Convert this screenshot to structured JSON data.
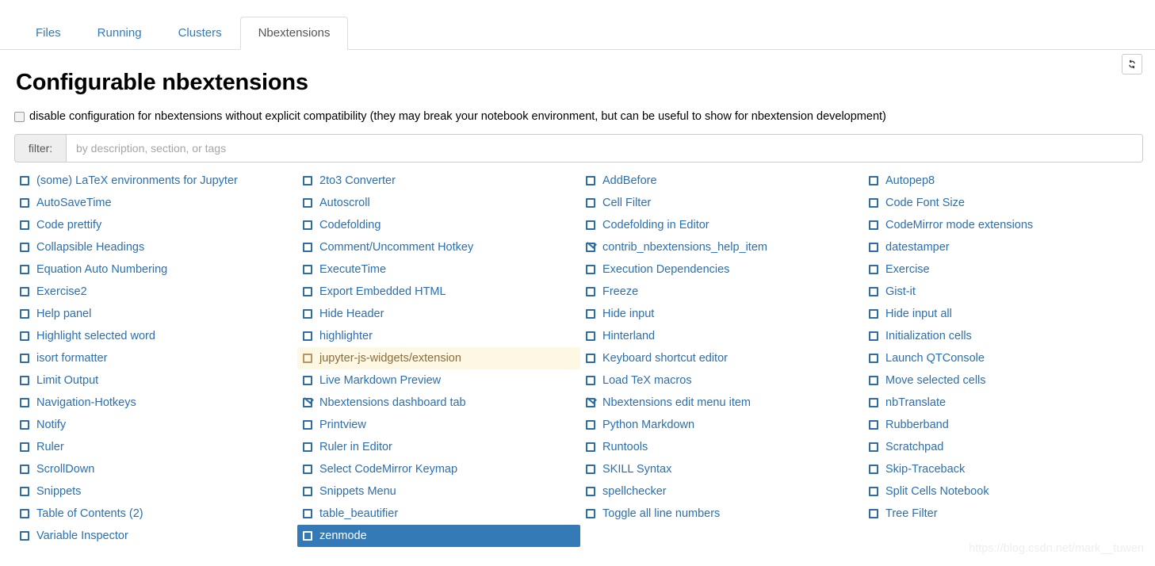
{
  "tabs": [
    {
      "label": "Files",
      "active": false
    },
    {
      "label": "Running",
      "active": false
    },
    {
      "label": "Clusters",
      "active": false
    },
    {
      "label": "Nbextensions",
      "active": true
    }
  ],
  "toolbar": {
    "refresh_icon": "refresh-icon",
    "refresh_title": "refresh"
  },
  "page": {
    "title": "Configurable nbextensions"
  },
  "disable_config": {
    "checked": false,
    "label": "disable configuration for nbextensions without explicit compatibility (they may break your notebook environment, but can be useful to show for nbextension development)"
  },
  "filter": {
    "addon_label": "filter:",
    "placeholder": "by description, section, or tags",
    "value": ""
  },
  "columns": [
    [
      {
        "label": "(some) LaTeX environments for Jupyter",
        "checked": false,
        "state": "normal"
      },
      {
        "label": "AutoSaveTime",
        "checked": false,
        "state": "normal"
      },
      {
        "label": "Code prettify",
        "checked": false,
        "state": "normal"
      },
      {
        "label": "Collapsible Headings",
        "checked": false,
        "state": "normal"
      },
      {
        "label": "Equation Auto Numbering",
        "checked": false,
        "state": "normal"
      },
      {
        "label": "Exercise2",
        "checked": false,
        "state": "normal"
      },
      {
        "label": "Help panel",
        "checked": false,
        "state": "normal"
      },
      {
        "label": "Highlight selected word",
        "checked": false,
        "state": "normal"
      },
      {
        "label": "isort formatter",
        "checked": false,
        "state": "normal"
      },
      {
        "label": "Limit Output",
        "checked": false,
        "state": "normal"
      },
      {
        "label": "Navigation-Hotkeys",
        "checked": false,
        "state": "normal"
      },
      {
        "label": "Notify",
        "checked": false,
        "state": "normal"
      },
      {
        "label": "Ruler",
        "checked": false,
        "state": "normal"
      },
      {
        "label": "ScrollDown",
        "checked": false,
        "state": "normal"
      },
      {
        "label": "Snippets",
        "checked": false,
        "state": "normal"
      },
      {
        "label": "Table of Contents (2)",
        "checked": false,
        "state": "normal"
      },
      {
        "label": "Variable Inspector",
        "checked": false,
        "state": "normal"
      }
    ],
    [
      {
        "label": "2to3 Converter",
        "checked": false,
        "state": "normal"
      },
      {
        "label": "Autoscroll",
        "checked": false,
        "state": "normal"
      },
      {
        "label": "Codefolding",
        "checked": false,
        "state": "normal"
      },
      {
        "label": "Comment/Uncomment Hotkey",
        "checked": false,
        "state": "normal"
      },
      {
        "label": "ExecuteTime",
        "checked": false,
        "state": "normal"
      },
      {
        "label": "Export Embedded HTML",
        "checked": false,
        "state": "normal"
      },
      {
        "label": "Hide Header",
        "checked": false,
        "state": "normal"
      },
      {
        "label": "highlighter",
        "checked": false,
        "state": "normal"
      },
      {
        "label": "jupyter-js-widgets/extension",
        "checked": false,
        "state": "warn"
      },
      {
        "label": "Live Markdown Preview",
        "checked": false,
        "state": "normal"
      },
      {
        "label": "Nbextensions dashboard tab",
        "checked": true,
        "state": "normal"
      },
      {
        "label": "Printview",
        "checked": false,
        "state": "normal"
      },
      {
        "label": "Ruler in Editor",
        "checked": false,
        "state": "normal"
      },
      {
        "label": "Select CodeMirror Keymap",
        "checked": false,
        "state": "normal"
      },
      {
        "label": "Snippets Menu",
        "checked": false,
        "state": "normal"
      },
      {
        "label": "table_beautifier",
        "checked": false,
        "state": "normal"
      },
      {
        "label": "zenmode",
        "checked": false,
        "state": "selected"
      }
    ],
    [
      {
        "label": "AddBefore",
        "checked": false,
        "state": "normal"
      },
      {
        "label": "Cell Filter",
        "checked": false,
        "state": "normal"
      },
      {
        "label": "Codefolding in Editor",
        "checked": false,
        "state": "normal"
      },
      {
        "label": "contrib_nbextensions_help_item",
        "checked": true,
        "state": "normal"
      },
      {
        "label": "Execution Dependencies",
        "checked": false,
        "state": "normal"
      },
      {
        "label": "Freeze",
        "checked": false,
        "state": "normal"
      },
      {
        "label": "Hide input",
        "checked": false,
        "state": "normal"
      },
      {
        "label": "Hinterland",
        "checked": false,
        "state": "normal"
      },
      {
        "label": "Keyboard shortcut editor",
        "checked": false,
        "state": "normal"
      },
      {
        "label": "Load TeX macros",
        "checked": false,
        "state": "normal"
      },
      {
        "label": "Nbextensions edit menu item",
        "checked": true,
        "state": "normal"
      },
      {
        "label": "Python Markdown",
        "checked": false,
        "state": "normal"
      },
      {
        "label": "Runtools",
        "checked": false,
        "state": "normal"
      },
      {
        "label": "SKILL Syntax",
        "checked": false,
        "state": "normal"
      },
      {
        "label": "spellchecker",
        "checked": false,
        "state": "normal"
      },
      {
        "label": "Toggle all line numbers",
        "checked": false,
        "state": "normal"
      }
    ],
    [
      {
        "label": "Autopep8",
        "checked": false,
        "state": "normal"
      },
      {
        "label": "Code Font Size",
        "checked": false,
        "state": "normal"
      },
      {
        "label": "CodeMirror mode extensions",
        "checked": false,
        "state": "normal"
      },
      {
        "label": "datestamper",
        "checked": false,
        "state": "normal"
      },
      {
        "label": "Exercise",
        "checked": false,
        "state": "normal"
      },
      {
        "label": "Gist-it",
        "checked": false,
        "state": "normal"
      },
      {
        "label": "Hide input all",
        "checked": false,
        "state": "normal"
      },
      {
        "label": "Initialization cells",
        "checked": false,
        "state": "normal"
      },
      {
        "label": "Launch QTConsole",
        "checked": false,
        "state": "normal"
      },
      {
        "label": "Move selected cells",
        "checked": false,
        "state": "normal"
      },
      {
        "label": "nbTranslate",
        "checked": false,
        "state": "normal"
      },
      {
        "label": "Rubberband",
        "checked": false,
        "state": "normal"
      },
      {
        "label": "Scratchpad",
        "checked": false,
        "state": "normal"
      },
      {
        "label": "Skip-Traceback",
        "checked": false,
        "state": "normal"
      },
      {
        "label": "Split Cells Notebook",
        "checked": false,
        "state": "normal"
      },
      {
        "label": "Tree Filter",
        "checked": false,
        "state": "normal"
      }
    ]
  ],
  "watermark": "https://blog.csdn.net/mark__tuwen",
  "colors": {
    "link": "#2c6fad",
    "selected_bg": "#337ab7",
    "warn_bg": "#fcf8e3",
    "warn_text": "#8a6d3b",
    "border": "#dddddd"
  }
}
